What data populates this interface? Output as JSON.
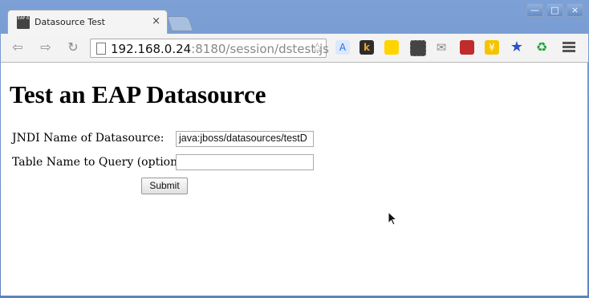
{
  "browser": {
    "tab": {
      "title": "Datasource Test",
      "close_glyph": "×",
      "favicon_text": "EAP 6"
    },
    "window_buttons": [
      "—",
      "□",
      "×"
    ],
    "url": {
      "host": "192.168.0.24",
      "rest": ":8180/session/dstest.js"
    },
    "extensions": [
      "translate-icon",
      "k-icon",
      "sticky-note-icon",
      "evernote-icon",
      "mail-icon",
      "book-icon",
      "coin-icon",
      "bookmark-star-icon",
      "recycle-icon"
    ]
  },
  "page": {
    "heading": "Test an EAP Datasource",
    "jndi_label": "JNDI Name of Datasource:",
    "jndi_value": "java:jboss/datasources/testD",
    "table_label": "Table Name to Query (optional):",
    "table_value": "",
    "submit_label": "Submit"
  }
}
